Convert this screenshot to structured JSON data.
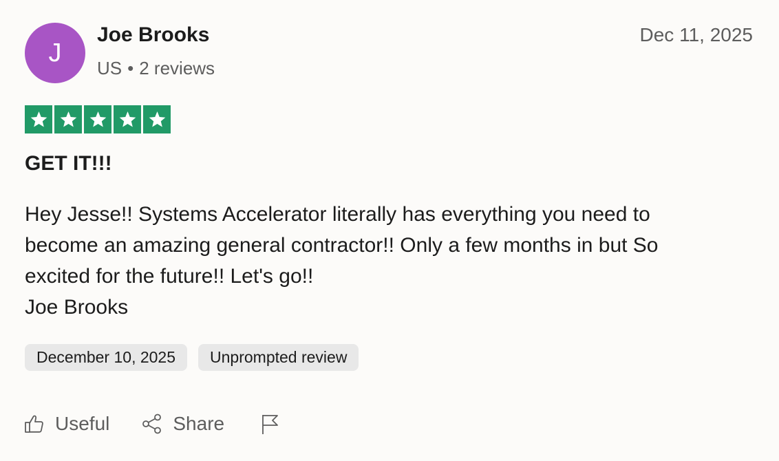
{
  "reviewer": {
    "initial": "J",
    "name": "Joe Brooks",
    "country": "US",
    "separator": "•",
    "review_count": "2 reviews",
    "avatar_color": "#a855c5"
  },
  "review": {
    "date": "Dec 11, 2025",
    "rating": 5,
    "max_rating": 5,
    "star_color": "#219a67",
    "title": "GET IT!!!",
    "body_lines": [
      "Hey Jesse!! Systems Accelerator literally has everything you need to",
      "become an amazing general contractor!! Only a few months in but So",
      "excited for the future!! Let's go!!",
      "Joe Brooks"
    ]
  },
  "tags": {
    "experience_date": "December 10, 2025",
    "review_type": "Unprompted review"
  },
  "actions": {
    "useful_label": "Useful",
    "useful_icon": "thumbs-up-icon",
    "share_label": "Share",
    "share_icon": "share-icon",
    "report_icon": "flag-icon"
  }
}
